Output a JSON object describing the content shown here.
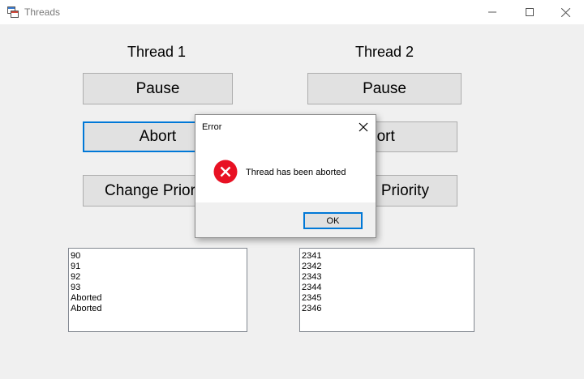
{
  "window": {
    "title": "Threads"
  },
  "thread1": {
    "title": "Thread 1",
    "pause_label": "Pause",
    "abort_label": "Abort",
    "priority_label": "Change Prior",
    "list": [
      "90",
      "91",
      "92",
      "93",
      "Aborted",
      "Aborted"
    ]
  },
  "thread2": {
    "title": "Thread 2",
    "pause_label": "Pause",
    "abort_label": "bort",
    "priority_label": "e Priority",
    "list": [
      "2341",
      "2342",
      "2343",
      "2344",
      "2345",
      "2346"
    ]
  },
  "dialog": {
    "title": "Error",
    "message": "Thread has been aborted",
    "ok_label": "OK"
  },
  "colors": {
    "accent": "#0078d7",
    "error": "#e81123"
  },
  "icons": {
    "app": "app-icon",
    "error": "error-icon",
    "close": "close-icon"
  }
}
